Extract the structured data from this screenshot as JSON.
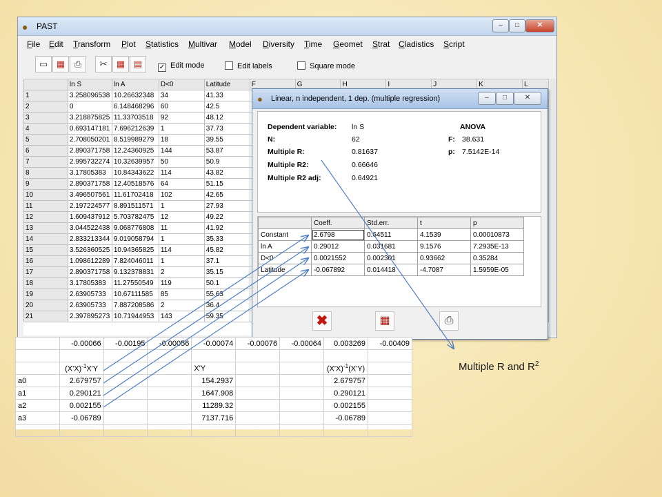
{
  "past_window": {
    "title": "PAST",
    "menu": [
      "File",
      "Edit",
      "Transform",
      "Plot",
      "Statistics",
      "Multivar",
      "Model",
      "Diversity",
      "Time",
      "Geomet",
      "Strat",
      "Cladistics",
      "Script"
    ],
    "checkboxes": [
      {
        "label": "Edit mode",
        "checked": true
      },
      {
        "label": "Edit labels",
        "checked": false
      },
      {
        "label": "Square mode",
        "checked": false
      }
    ],
    "columns": [
      "ln S",
      "ln A",
      "D<0",
      "Latitude",
      "F",
      "G",
      "H",
      "I",
      "J",
      "K",
      "L"
    ],
    "rows": [
      {
        "id": "1",
        "v": [
          "3.258096538",
          "10.26632348",
          "34",
          "41.33"
        ]
      },
      {
        "id": "2",
        "v": [
          "0",
          "6.148468296",
          "60",
          "42.5"
        ]
      },
      {
        "id": "3",
        "v": [
          "3.218875825",
          "11.33703518",
          "92",
          "48.12"
        ]
      },
      {
        "id": "4",
        "v": [
          "0.693147181",
          "7.696212639",
          "1",
          "37.73"
        ]
      },
      {
        "id": "5",
        "v": [
          "2.708050201",
          "8.519989279",
          "18",
          "39.55"
        ]
      },
      {
        "id": "6",
        "v": [
          "2.890371758",
          "12.24360925",
          "144",
          "53.87"
        ]
      },
      {
        "id": "7",
        "v": [
          "2.995732274",
          "10.32639957",
          "50",
          "50.9"
        ]
      },
      {
        "id": "8",
        "v": [
          "3.17805383",
          "10.84343622",
          "114",
          "43.82"
        ]
      },
      {
        "id": "9",
        "v": [
          "2.890371758",
          "12.40518576",
          "64",
          "51.15"
        ]
      },
      {
        "id": "10",
        "v": [
          "3.496507561",
          "11.61702418",
          "102",
          "42.65"
        ]
      },
      {
        "id": "11",
        "v": [
          "2.197224577",
          "8.891511571",
          "1",
          "27.93"
        ]
      },
      {
        "id": "12",
        "v": [
          "1.609437912",
          "5.703782475",
          "12",
          "49.22"
        ]
      },
      {
        "id": "13",
        "v": [
          "3.044522438",
          "9.068776808",
          "11",
          "41.92"
        ]
      },
      {
        "id": "14",
        "v": [
          "2.833213344",
          "9.019058794",
          "1",
          "35.33"
        ]
      },
      {
        "id": "15",
        "v": [
          "3.526360525",
          "10.94365825",
          "114",
          "45.82"
        ]
      },
      {
        "id": "16",
        "v": [
          "1.098612289",
          "7.824046011",
          "1",
          "37.1"
        ]
      },
      {
        "id": "17",
        "v": [
          "2.890371758",
          "9.132378831",
          "2",
          "35.15"
        ]
      },
      {
        "id": "18",
        "v": [
          "3.17805383",
          "11.27550549",
          "119",
          "50.1"
        ]
      },
      {
        "id": "19",
        "v": [
          "2.63905733",
          "10.67111585",
          "85",
          "55.63"
        ]
      },
      {
        "id": "20",
        "v": [
          "2.63905733",
          "7.887208586",
          "2",
          "36.4"
        ]
      },
      {
        "id": "21",
        "v": [
          "2.397895273",
          "10.71944953",
          "143",
          "59.35"
        ]
      }
    ]
  },
  "dialog": {
    "title": "Linear, n independent, 1 dep. (multiple regression)",
    "dependent_label": "Dependent variable:",
    "dependent_value": "ln S",
    "n_label": "N:",
    "n_value": "62",
    "multiple_r_label": "Multiple R:",
    "multiple_r_value": "0.81637",
    "multiple_r2_label": "Multiple R2:",
    "multiple_r2_value": "0.66646",
    "multiple_r2adj_label": "Multiple R2 adj:",
    "multiple_r2adj_value": "0.64921",
    "anova_label": "ANOVA",
    "f_label": "F:",
    "f_value": "38.631",
    "p_label": "p:",
    "p_value": "7.5142E-14",
    "table_headers": [
      "",
      "Coeff.",
      "Std.err.",
      "t",
      "p"
    ],
    "table_rows": [
      [
        "Constant",
        "2.6798",
        "0.64511",
        "4.1539",
        "0.00010873"
      ],
      [
        "ln A",
        "0.29012",
        "0.031681",
        "9.1576",
        "7.2935E-13"
      ],
      [
        "D<0",
        "0.0021552",
        "0.002301",
        "0.93662",
        "0.35284"
      ],
      [
        "Latitude",
        "-0.067892",
        "0.014418",
        "-4.7087",
        "1.5959E-05"
      ]
    ]
  },
  "excel": {
    "top_row": [
      "-0.00066",
      "-0.00195",
      "-0.00056",
      "-0.00074",
      "-0.00076",
      "-0.00064",
      "0.003269",
      "-0.00409"
    ],
    "header_xtx": "(X'X)",
    "header_xtx_sup": "-1",
    "header_xty_suffix": "X'Y",
    "header_xy": "X'Y",
    "header_result": "(X'X)",
    "header_result_sup": "-1",
    "header_result_suffix": "(X'Y)",
    "rows": [
      {
        "label": "a0",
        "coef": "2.679757",
        "xy": "154.2937",
        "result": "2.679757"
      },
      {
        "label": "a1",
        "coef": "0.290121",
        "xy": "1647.908",
        "result": "0.290121"
      },
      {
        "label": "a2",
        "coef": "0.002155",
        "xy": "11289.32",
        "result": "0.002155"
      },
      {
        "label": "a3",
        "coef": "-0.06789",
        "xy": "7137.716",
        "result": "-0.06789"
      }
    ]
  },
  "caption": {
    "text": "Multiple R and R",
    "sup": "2"
  },
  "colors": {
    "arrow": "#4f7fc4",
    "close_red": "#c3180f"
  }
}
